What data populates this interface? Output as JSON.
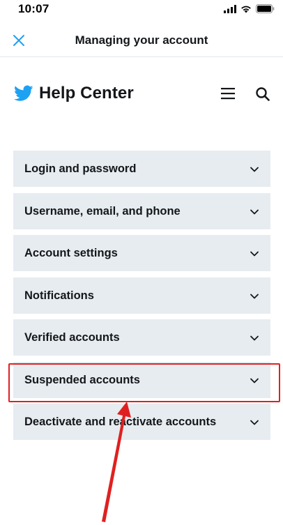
{
  "status_bar": {
    "time": "10:07"
  },
  "header": {
    "title": "Managing your account",
    "close_icon": "close-icon"
  },
  "help_center": {
    "brand": "Help Center",
    "logo_icon": "twitter-bird-icon",
    "menu_icon": "hamburger-menu-icon",
    "search_icon": "search-icon"
  },
  "topics": [
    {
      "label": "Login and password"
    },
    {
      "label": "Username, email, and phone"
    },
    {
      "label": "Account settings"
    },
    {
      "label": "Notifications"
    },
    {
      "label": "Verified accounts"
    },
    {
      "label": "Suspended accounts"
    },
    {
      "label": "Deactivate and reactivate accounts"
    }
  ],
  "colors": {
    "twitter_blue": "#1da1f2",
    "item_background": "#e6ecf0",
    "annotation_red": "#e02020"
  }
}
